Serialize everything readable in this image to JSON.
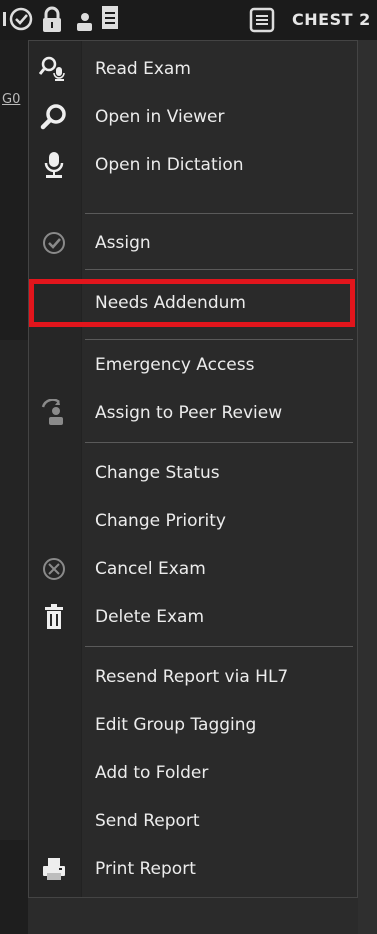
{
  "header": {
    "title": "CHEST 2"
  },
  "left": {
    "link_text": "G0"
  },
  "menu": {
    "items": [
      {
        "label": "Read Exam",
        "icon": "read-exam-icon"
      },
      {
        "label": "Open in Viewer",
        "icon": "magnifier-icon"
      },
      {
        "label": "Open in Dictation",
        "icon": "microphone-icon"
      },
      {
        "label": "Assign",
        "icon": "check-circle-icon"
      },
      {
        "label": "Needs Addendum",
        "icon": ""
      },
      {
        "label": "Emergency Access",
        "icon": ""
      },
      {
        "label": "Assign to Peer Review",
        "icon": "peer-review-icon"
      },
      {
        "label": "Change Status",
        "icon": ""
      },
      {
        "label": "Change Priority",
        "icon": ""
      },
      {
        "label": "Cancel Exam",
        "icon": "cancel-circle-icon"
      },
      {
        "label": "Delete Exam",
        "icon": "trash-icon"
      },
      {
        "label": "Resend Report via HL7",
        "icon": ""
      },
      {
        "label": "Edit Group Tagging",
        "icon": ""
      },
      {
        "label": "Add to Folder",
        "icon": ""
      },
      {
        "label": "Send Report",
        "icon": ""
      },
      {
        "label": "Print Report",
        "icon": "printer-icon"
      }
    ],
    "highlighted_item": "Needs Addendum",
    "highlight_color": "#e2151c"
  }
}
